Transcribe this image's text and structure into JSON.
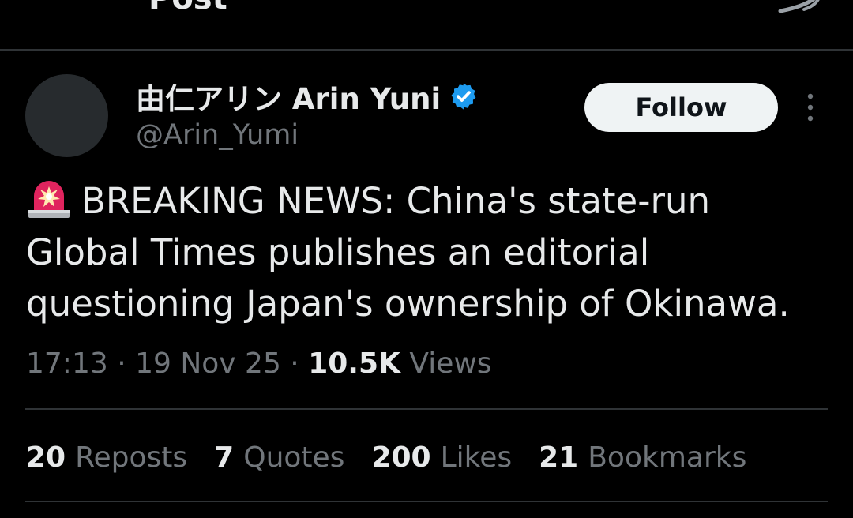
{
  "header": {
    "title": "Post",
    "back_icon": "arrow-left-icon",
    "grok_icon": "grok-icon"
  },
  "author": {
    "display_name": "由仁アリン Arin Yuni",
    "handle": "@Arin_Yumi",
    "verified": true,
    "verified_color": "#1d9bf0",
    "avatar_color": "#272b2e"
  },
  "actions": {
    "follow_label": "Follow",
    "more_icon": "more-vertical-icon"
  },
  "tweet": {
    "icon": "rotating-light-icon",
    "text": "BREAKING NEWS: China's state-run Global Times publishes an editorial questioning Japan's ownership of Okinawa."
  },
  "meta": {
    "time": "17:13",
    "separator": " · ",
    "date": "19 Nov 25",
    "views_count": "10.5K",
    "views_label": "Views"
  },
  "stats": [
    {
      "count": "20",
      "label": "Reposts"
    },
    {
      "count": "7",
      "label": "Quotes"
    },
    {
      "count": "200",
      "label": "Likes"
    },
    {
      "count": "21",
      "label": "Bookmarks"
    }
  ],
  "colors": {
    "background": "#000000",
    "text": "#e7e9ea",
    "secondary": "#71767b",
    "divider": "#2f3336",
    "button_bg": "#eff3f4"
  }
}
